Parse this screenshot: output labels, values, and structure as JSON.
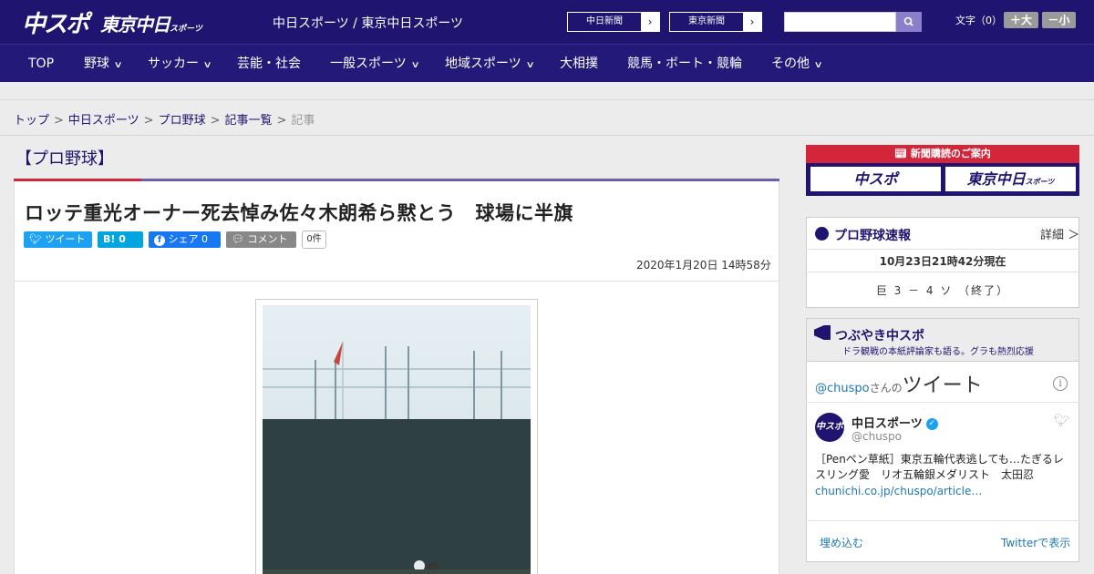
{
  "header": {
    "logo_main": "中スポ",
    "logo_tokyo": "東京中日",
    "logo_tokyo_small": "スポーツ",
    "site_title": "中日スポーツ / 東京中日スポーツ",
    "portal_buttons": [
      "中日新聞",
      "東京新聞"
    ],
    "font_label": "文字（0）",
    "font_larger": "＋大",
    "font_smaller": "－小"
  },
  "nav": {
    "items": [
      {
        "label": "TOP",
        "dropdown": false
      },
      {
        "label": "野球",
        "dropdown": true
      },
      {
        "label": "サッカー",
        "dropdown": true
      },
      {
        "label": "芸能・社会",
        "dropdown": false
      },
      {
        "label": "一般スポーツ",
        "dropdown": true
      },
      {
        "label": "地域スポーツ",
        "dropdown": true
      },
      {
        "label": "大相撲",
        "dropdown": false
      },
      {
        "label": "競馬・ボート・競輪",
        "dropdown": false
      },
      {
        "label": "その他",
        "dropdown": true
      }
    ]
  },
  "breadcrumb": {
    "links": [
      "トップ",
      "中日スポーツ",
      "プロ野球",
      "記事一覧"
    ],
    "current": "記事"
  },
  "article": {
    "section": "【プロ野球】",
    "headline": "ロッテ重光オーナー死去悼み佐々木朗希ら黙とう　球場に半旗",
    "share": {
      "tweet": "ツイート",
      "hatena": "B! 0",
      "facebook": "シェア 0",
      "comment": "コメント",
      "comment_count": "0件"
    },
    "datetime": "2020年1月20日 14時58分"
  },
  "sidebar": {
    "subscribe_banner": "新聞購読のご案内",
    "subscribe_buttons": [
      "中スポ",
      "東京中日"
    ],
    "subscribe_button_small": "スポーツ",
    "score": {
      "title": "プロ野球速報",
      "detail": "詳細 ＞",
      "updated": "10月23日21時42分現在",
      "game": "巨 3 － 4 ソ （終了）"
    },
    "tweets": {
      "title": "つぶやき中スポ",
      "subtitle": "ドラ観戦の本紙評論家も語る。グラも熱烈応援",
      "handle_prefix": "@chuspo",
      "handle_suffix": "さんの",
      "big_label": "ツイート",
      "avatar_text": "中スポ",
      "account_name": "中日スポーツ",
      "account_handle": "@chuspo",
      "tweet_text": "［Penペン草紙］東京五輪代表逃しても…たぎるレスリング愛　リオ五輪銀メダリスト　太田忍",
      "tweet_link": "chunichi.co.jp/chuspo/article…",
      "embed": "埋め込む",
      "view_on_twitter": "Twitterで表示"
    }
  },
  "colors": {
    "brand_navy": "#1f1571",
    "accent_red": "#d3263b",
    "twitter_blue": "#1da1f2",
    "facebook_blue": "#1877f2",
    "hatena_blue": "#00a4de"
  }
}
